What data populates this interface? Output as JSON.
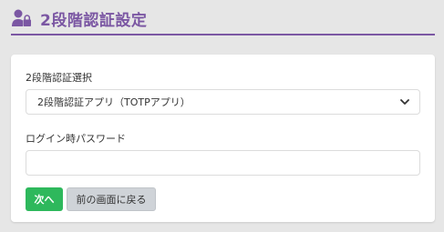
{
  "header": {
    "title": "2段階認証設定",
    "icon": "user-lock-icon",
    "accent_color": "#7b57a3"
  },
  "form": {
    "method_label": "2段階認証選択",
    "method_selected": "2段階認証アプリ（TOTPアプリ）",
    "password_label": "ログイン時パスワード",
    "password_value": "",
    "password_placeholder": ""
  },
  "buttons": {
    "next_label": "次へ",
    "next_color": "#2eb85c",
    "back_label": "前の画面に戻る",
    "back_color": "#cfd3d8"
  }
}
